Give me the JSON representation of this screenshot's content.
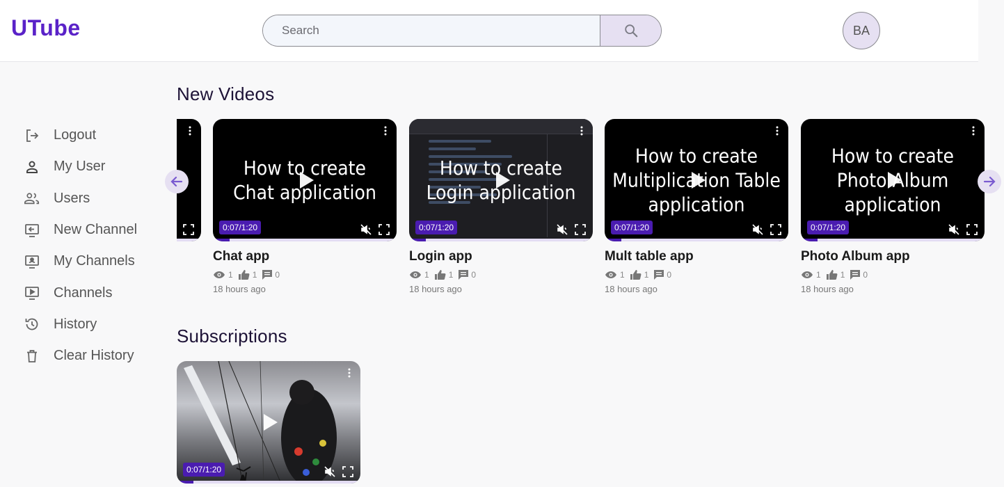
{
  "header": {
    "logo": "UTube",
    "search_placeholder": "Search",
    "avatar_initials": "BA"
  },
  "sidebar": {
    "items": [
      {
        "label": "Logout",
        "icon": "logout-icon"
      },
      {
        "label": "My User",
        "icon": "person-icon"
      },
      {
        "label": "Users",
        "icon": "people-icon"
      },
      {
        "label": "New Channel",
        "icon": "new-channel-icon"
      },
      {
        "label": "My Channels",
        "icon": "my-channels-icon"
      },
      {
        "label": "Channels",
        "icon": "channels-icon"
      },
      {
        "label": "History",
        "icon": "history-icon"
      },
      {
        "label": "Clear History",
        "icon": "trash-icon"
      }
    ]
  },
  "new_videos": {
    "title": "New Videos",
    "cards": [
      {
        "title": "Chat app",
        "thumb_text": [
          "How to create",
          "Chat application"
        ],
        "time": "0:07/1:20",
        "progress": 0.09,
        "views": "1",
        "likes": "1",
        "comments": "0",
        "ago": "18 hours ago"
      },
      {
        "title": "Login app",
        "thumb_text": [
          "How to create",
          "Login application"
        ],
        "time": "0:07/1:20",
        "progress": 0.09,
        "views": "1",
        "likes": "1",
        "comments": "0",
        "ago": "18 hours ago"
      },
      {
        "title": "Mult table app",
        "thumb_text": [
          "How to create",
          "Multiplication Table",
          "application"
        ],
        "time": "0:07/1:20",
        "progress": 0.09,
        "views": "1",
        "likes": "1",
        "comments": "0",
        "ago": "18 hours ago"
      },
      {
        "title": "Photo Album app",
        "thumb_text": [
          "How to create",
          "Photo Album",
          "application"
        ],
        "time": "0:07/1:20",
        "progress": 0.09,
        "views": "1",
        "likes": "1",
        "comments": "0",
        "ago": "18 hours ago"
      }
    ]
  },
  "subscriptions": {
    "title": "Subscriptions",
    "cards": [
      {
        "time": "0:07/1:20",
        "progress": 0.09
      }
    ]
  },
  "colors": {
    "brand": "#5a22c8",
    "accent": "#4a1cb0",
    "accent_light": "#e6e0f2"
  }
}
